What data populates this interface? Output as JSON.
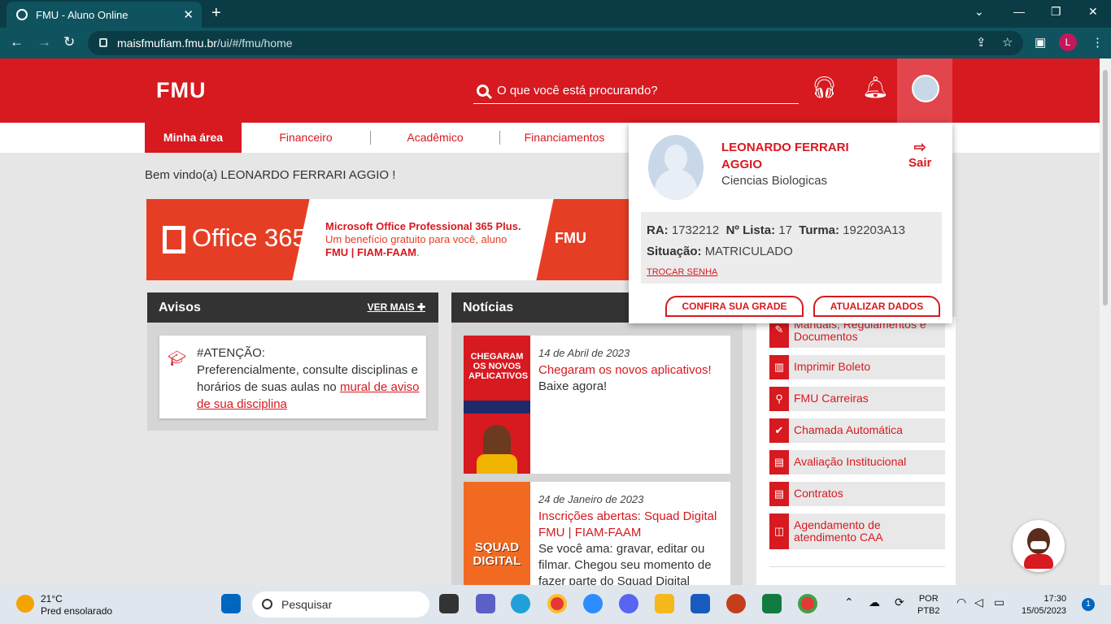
{
  "browser": {
    "tab_title": "FMU - Aluno Online",
    "url_domain": "maisfmufiam.fmu.br",
    "url_path": "/ui/#/fmu/home",
    "profile_initial": "L"
  },
  "header": {
    "logo": "FMU",
    "search_placeholder": "O que você está procurando?"
  },
  "menu": {
    "items": [
      {
        "label": "Minha área"
      },
      {
        "label": "Financeiro"
      },
      {
        "label": "Acadêmico"
      },
      {
        "label": "Financiamentos"
      }
    ]
  },
  "welcome": "Bem vindo(a) LEONARDO FERRARI AGGIO !",
  "banner": {
    "office_label": "Office 365",
    "line1": "Microsoft Office Professional 365 Plus.",
    "line2": "Um benefício gratuito para você, aluno",
    "line3": "FMU | FIAM-FAAM",
    "line3_suffix": ".",
    "brand": "FMU"
  },
  "avisos": {
    "title": "Avisos",
    "ver_mais": "VER MAIS",
    "item": {
      "heading": "#ATENÇÃO:",
      "text": "Preferencialmente, consulte disciplinas e horários de suas aulas no ",
      "link": "mural de aviso de sua disciplina"
    }
  },
  "noticias": {
    "title": "Notícias",
    "items": [
      {
        "date": "14 de Abril de 2023",
        "title": "Chegaram os novos aplicativos!",
        "text": "Baixe agora!",
        "img_caption": "CHEGARAM OS NOVOS APLICATIVOS"
      },
      {
        "date": "24 de Janeiro de 2023",
        "title": "Inscrições abertas: Squad Digital FMU | FIAM-FAAM",
        "text": "Se você ama: gravar, editar ou filmar. Chegou seu momento de fazer parte do Squad Digital",
        "img_caption": "SQUAD DIGITAL"
      }
    ]
  },
  "quick_links": [
    {
      "label": "Manuais, Regulamentos e Documentos",
      "icon": "wrench-icon"
    },
    {
      "label": "Imprimir Boleto",
      "icon": "barcode-icon"
    },
    {
      "label": "FMU Carreiras",
      "icon": "search-icon"
    },
    {
      "label": "Chamada Automática",
      "icon": "check-icon"
    },
    {
      "label": "Avaliação Institucional",
      "icon": "book-icon"
    },
    {
      "label": "Contratos",
      "icon": "book-icon"
    },
    {
      "label": "Agendamento de atendimento CAA",
      "icon": "calendar-icon"
    }
  ],
  "profile": {
    "name": "LEONARDO FERRARI AGGIO",
    "course": "Ciencias Biologicas",
    "sair": "Sair",
    "ra_label": "RA:",
    "ra": "1732212",
    "lista_label": "Nº Lista:",
    "lista": "17",
    "turma_label": "Turma:",
    "turma": "192203A13",
    "situacao_label": "Situação:",
    "situacao": "MATRICULADO",
    "trocar_senha": "TROCAR SENHA",
    "btn_grade": "CONFIRA SUA GRADE",
    "btn_dados": "ATUALIZAR DADOS"
  },
  "taskbar": {
    "temp": "21°C",
    "weather": "Pred ensolarado",
    "search": "Pesquisar",
    "lang1": "POR",
    "lang2": "PTB2",
    "time": "17:30",
    "date": "15/05/2023",
    "notifications": "1"
  },
  "colors": {
    "brand_red": "#d71920",
    "chrome_teal": "#0f535f"
  }
}
